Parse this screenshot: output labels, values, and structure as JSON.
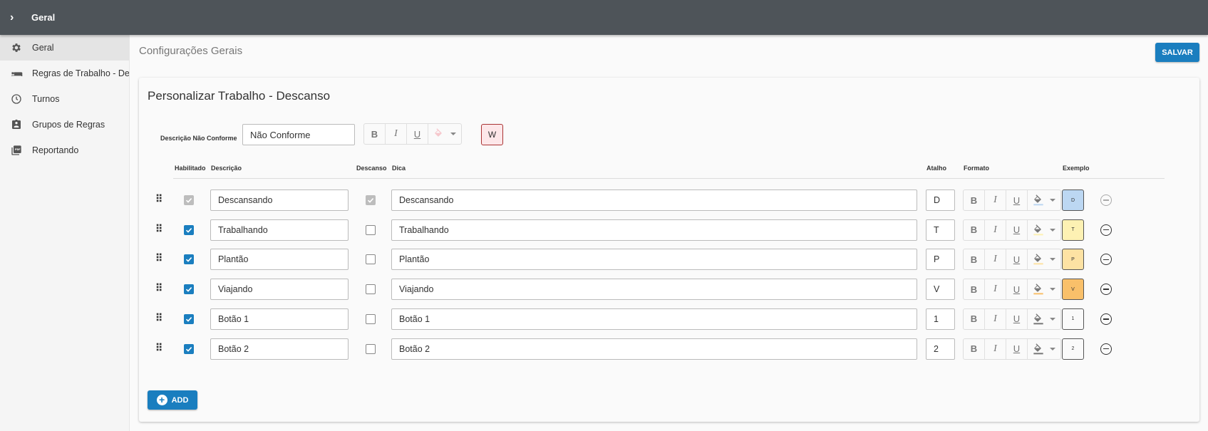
{
  "topbar": {
    "chevron_icon": "chevron-right-icon",
    "title": "Geral"
  },
  "sidebar": {
    "items": [
      {
        "label": "Geral",
        "icon": "gear-icon",
        "active": true
      },
      {
        "label": "Regras de Trabalho - Descanso",
        "icon": "bed-icon",
        "active": false
      },
      {
        "label": "Turnos",
        "icon": "clock-icon",
        "active": false
      },
      {
        "label": "Grupos de Regras",
        "icon": "clipboard-user-icon",
        "active": false
      },
      {
        "label": "Reportando",
        "icon": "pdf-icon",
        "active": false
      }
    ]
  },
  "main": {
    "page_title": "Configurações Gerais",
    "save_label": "SALVAR"
  },
  "card": {
    "title": "Personalizar Trabalho - Descanso",
    "non_conform": {
      "label": "Descrição Não Conforme",
      "value": "Não Conforme",
      "example": "W",
      "example_color": "#fde7e9"
    },
    "headers": {
      "enabled": "Habilitado",
      "description": "Descrição",
      "rest": "Descanso",
      "hint": "Dica",
      "shortcut": "Atalho",
      "format": "Formato",
      "example": "Exemplo"
    },
    "format_labels": {
      "bold": "B",
      "italic": "I",
      "underline": "U"
    },
    "rows": [
      {
        "enabled": true,
        "enabled_locked": true,
        "description": "Descansando",
        "rest": true,
        "rest_locked": true,
        "hint": "Descansando",
        "shortcut": "D",
        "example": "D",
        "color": "#bcd7f2",
        "remove_disabled": true
      },
      {
        "enabled": true,
        "enabled_locked": false,
        "description": "Trabalhando",
        "rest": false,
        "rest_locked": false,
        "hint": "Trabalhando",
        "shortcut": "T",
        "example": "T",
        "color": "#fdf1b3",
        "remove_disabled": false
      },
      {
        "enabled": true,
        "enabled_locked": false,
        "description": "Plantão",
        "rest": false,
        "rest_locked": false,
        "hint": "Plantão",
        "shortcut": "P",
        "example": "P",
        "color": "#fde2a3",
        "remove_disabled": false
      },
      {
        "enabled": true,
        "enabled_locked": false,
        "description": "Viajando",
        "rest": false,
        "rest_locked": false,
        "hint": "Viajando",
        "shortcut": "V",
        "example": "V",
        "color": "#f9c06a",
        "remove_disabled": false
      },
      {
        "enabled": true,
        "enabled_locked": false,
        "description": "Botão 1",
        "rest": false,
        "rest_locked": false,
        "hint": "Botão 1",
        "shortcut": "1",
        "example": "1",
        "color": "#fafafa",
        "remove_disabled": false
      },
      {
        "enabled": true,
        "enabled_locked": false,
        "description": "Botão 2",
        "rest": false,
        "rest_locked": false,
        "hint": "Botão 2",
        "shortcut": "2",
        "example": "2",
        "color": "#fafafa",
        "remove_disabled": false
      }
    ],
    "add_label": "ADD"
  }
}
